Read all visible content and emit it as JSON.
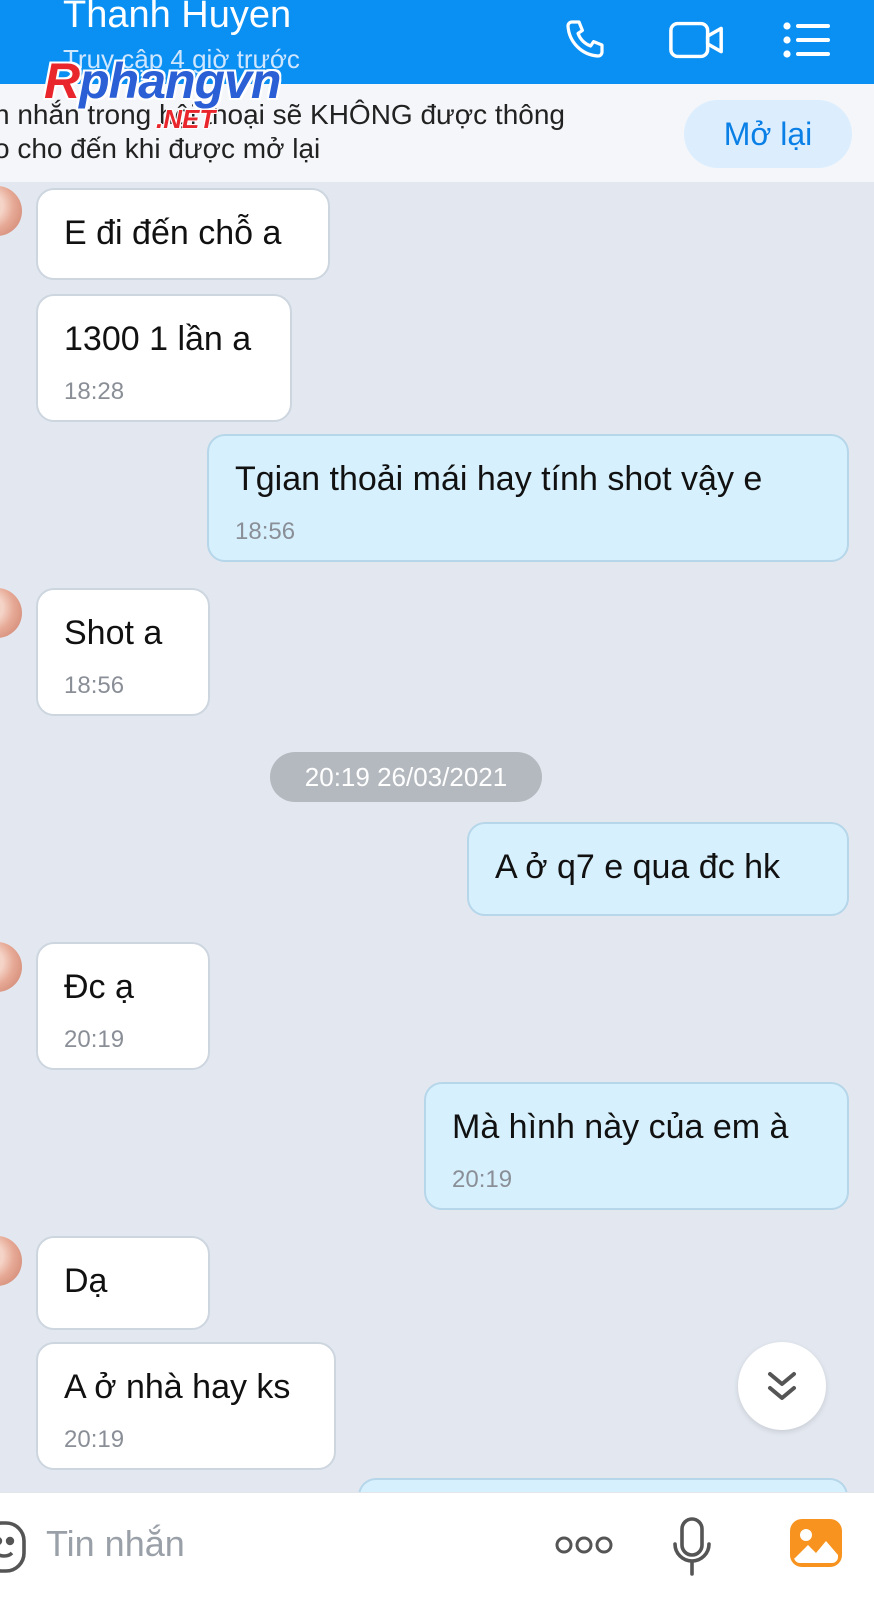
{
  "header": {
    "contact_name": "Thanh Huyen",
    "status": "Truy cập 4 giờ trước",
    "icons": [
      "phone-icon",
      "video-call-icon",
      "menu-list-icon"
    ]
  },
  "watermark": {
    "main_a": "R",
    "main_b": "phangvn",
    "sub": ".NET"
  },
  "banner": {
    "text": "n nhắn trong hội thoại sẽ KHÔNG được thông\no cho đến khi được mở lại",
    "reopen_label": "Mở lại"
  },
  "messages": [
    {
      "direction": "in",
      "text": "E đi đến chỗ a",
      "time": ""
    },
    {
      "direction": "in",
      "text": "1300 1 lần a",
      "time": "18:28"
    },
    {
      "direction": "out",
      "text": "Tgian thoải mái hay tính shot vậy e",
      "time": "18:56"
    },
    {
      "direction": "in",
      "text": "Shot a",
      "time": "18:56"
    },
    {
      "direction": "out",
      "text": "A ở q7 e qua đc hk",
      "time": ""
    },
    {
      "direction": "in",
      "text": "Đc ạ",
      "time": "20:19"
    },
    {
      "direction": "out",
      "text": "Mà hình này của em à",
      "time": "20:19"
    },
    {
      "direction": "in",
      "text": "Dạ",
      "time": ""
    },
    {
      "direction": "in",
      "text": "A ở nhà hay ks",
      "time": "20:19"
    }
  ],
  "date_separator": "20:19 26/03/2021",
  "composer": {
    "placeholder": "Tin nhắn",
    "icons": [
      "sticker-icon",
      "more-options-icon",
      "microphone-icon",
      "gallery-icon"
    ]
  },
  "colors": {
    "header": "#0a8ff3",
    "outgoing_bubble": "#d7f0fd",
    "incoming_bubble": "#ffffff",
    "chat_background": "#e3e8f0",
    "accent": "#0a7fe6"
  }
}
